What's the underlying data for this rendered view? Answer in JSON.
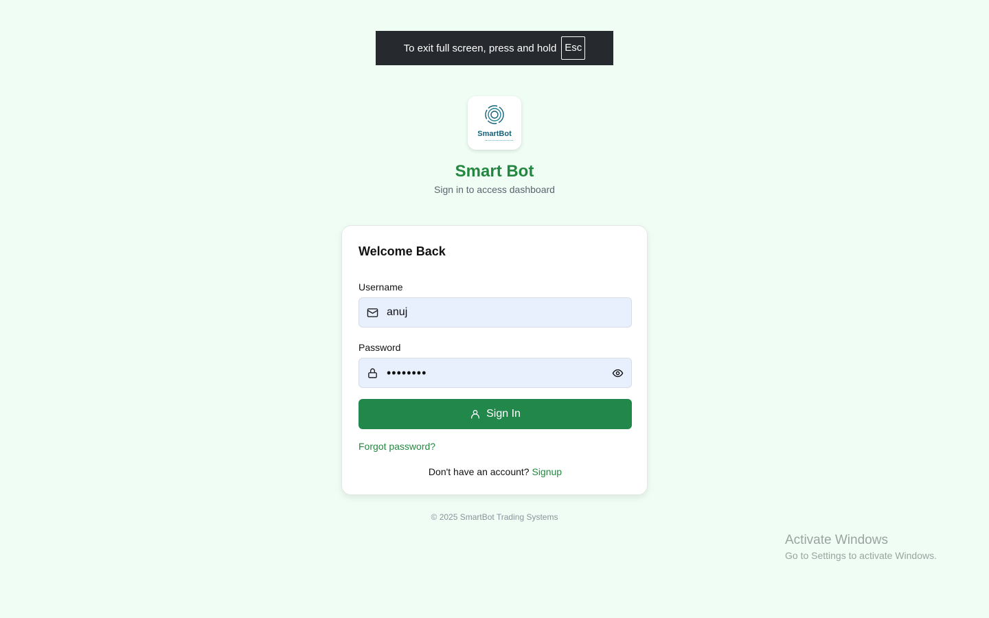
{
  "fullscreen_notice": {
    "message": "To exit full screen, press and hold",
    "key": "Esc"
  },
  "brand": {
    "logo_text": "SmartBot",
    "title": "Smart Bot",
    "subtitle": "Sign in to access dashboard"
  },
  "login_card": {
    "title": "Welcome Back",
    "username": {
      "label": "Username",
      "value": "anuj",
      "icon": "mail-icon"
    },
    "password": {
      "label": "Password",
      "masked_value": "••••••••",
      "icon": "lock-icon",
      "toggle_icon": "eye-icon"
    },
    "sign_in_label": "Sign In",
    "forgot_password": "Forgot password?",
    "no_account_text": "Don't have an account?",
    "signup_label": "Signup"
  },
  "footer": {
    "copyright": "© 2025 SmartBot Trading Systems"
  },
  "windows_watermark": {
    "title": "Activate Windows",
    "subtitle": "Go to Settings to activate Windows."
  },
  "colors": {
    "background": "#effdf4",
    "brand_green": "#23873f",
    "button_green": "#22874a",
    "input_bg": "#e8effd",
    "logo_blue": "#14607a"
  }
}
